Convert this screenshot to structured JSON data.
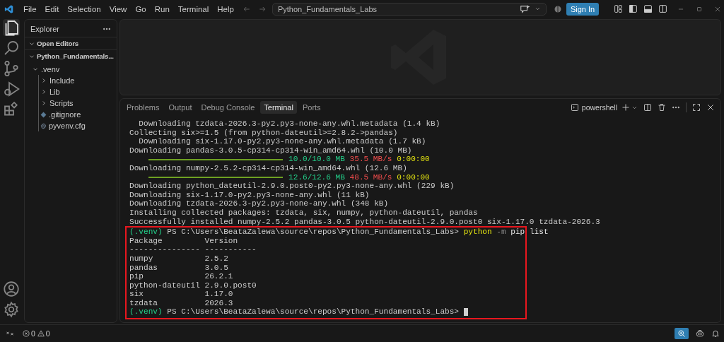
{
  "title_bar": {
    "menu": [
      "File",
      "Edit",
      "Selection",
      "View",
      "Go",
      "Run",
      "Terminal",
      "Help"
    ],
    "command_center": "Python_Fundamentals_Labs",
    "sign_in": "Sign In"
  },
  "activity_bar": {
    "items": [
      {
        "kind": "explorer",
        "selected": true
      },
      {
        "kind": "search",
        "selected": false
      },
      {
        "kind": "source-control",
        "selected": false
      },
      {
        "kind": "run-debug",
        "selected": false
      },
      {
        "kind": "extensions",
        "selected": false
      }
    ],
    "bottom": [
      {
        "kind": "account"
      },
      {
        "kind": "settings"
      }
    ]
  },
  "sidebar": {
    "title": "Explorer",
    "sections": [
      {
        "label": "Open Editors",
        "expanded": true
      },
      {
        "label": "Python_Fundamentals...",
        "expanded": true,
        "tree": [
          {
            "label": ".venv",
            "kind": "folder",
            "expanded": true,
            "children": [
              {
                "label": "Include",
                "kind": "folder",
                "expanded": false
              },
              {
                "label": "Lib",
                "kind": "folder",
                "expanded": false
              },
              {
                "label": "Scripts",
                "kind": "folder",
                "expanded": false
              },
              {
                "label": ".gitignore",
                "kind": "git-file"
              },
              {
                "label": "pyvenv.cfg",
                "kind": "config-file"
              }
            ]
          }
        ]
      }
    ]
  },
  "panel": {
    "tabs": [
      {
        "label": "Problems",
        "selected": false
      },
      {
        "label": "Output",
        "selected": false
      },
      {
        "label": "Debug Console",
        "selected": false
      },
      {
        "label": "Terminal",
        "selected": true
      },
      {
        "label": "Ports",
        "selected": false
      }
    ],
    "shell": "powershell",
    "lines": [
      {
        "kind": "text",
        "text": "  Downloading tzdata-2026.3-py2.py3-none-any.whl.metadata (1.4 kB)"
      },
      {
        "kind": "text",
        "text": "Collecting six>=1.5 (from python-dateutil>=2.8.2->pandas)"
      },
      {
        "kind": "text",
        "text": "  Downloading six-1.17.0-py2.py3-none-any.whl.metadata (1.7 kB)"
      },
      {
        "kind": "text",
        "text": "Downloading pandas-3.0.5-cp314-cp314-win_amd64.whl (10.0 MB)"
      },
      {
        "kind": "progress",
        "level": 1,
        "amount": "10.0/10.0 MB",
        "speed": "35.5 MB/s",
        "eta": "0:00:00"
      },
      {
        "kind": "text",
        "text": "Downloading numpy-2.5.2-cp314-cp314-win_amd64.whl (12.6 MB)"
      },
      {
        "kind": "progress",
        "level": 1,
        "amount": "12.6/12.6 MB",
        "speed": "48.5 MB/s",
        "eta": "0:00:00"
      },
      {
        "kind": "text",
        "text": "Downloading python_dateutil-2.9.0.post0-py2.py3-none-any.whl (229 kB)"
      },
      {
        "kind": "text",
        "text": "Downloading six-1.17.0-py2.py3-none-any.whl (11 kB)"
      },
      {
        "kind": "text",
        "text": "Downloading tzdata-2026.3-py2.py3-none-any.whl (348 kB)"
      },
      {
        "kind": "text",
        "text": "Installing collected packages: tzdata, six, numpy, python-dateutil, pandas"
      },
      {
        "kind": "text",
        "text": "Successfully installed numpy-2.5.2 pandas-3.0.5 python-dateutil-2.9.0.post0 six-1.17.0 tzdata-2026.3"
      }
    ],
    "highlighted_lines": [
      {
        "kind": "prompt",
        "venv": "(.venv)",
        "path": " PS C:\\Users\\BeataZalewa\\source\\repos\\Python_Fundamentals_Labs> ",
        "command": "python",
        "flag": " -m",
        "args": " pip list"
      },
      {
        "kind": "text",
        "text": "Package         Version"
      },
      {
        "kind": "text",
        "text": "--------------- -----------"
      },
      {
        "kind": "text",
        "text": "numpy           2.5.2"
      },
      {
        "kind": "text",
        "text": "pandas          3.0.5"
      },
      {
        "kind": "text",
        "text": "pip             26.2.1"
      },
      {
        "kind": "text",
        "text": "python-dateutil 2.9.0.post0"
      },
      {
        "kind": "text",
        "text": "six             1.17.0"
      },
      {
        "kind": "text",
        "text": "tzdata          2026.3"
      },
      {
        "kind": "prompt",
        "venv": "(.venv)",
        "path": " PS C:\\Users\\BeataZalewa\\source\\repos\\Python_Fundamentals_Labs> ",
        "cursor": true
      }
    ]
  },
  "status_bar": {
    "errors": "0",
    "warnings": "0"
  }
}
